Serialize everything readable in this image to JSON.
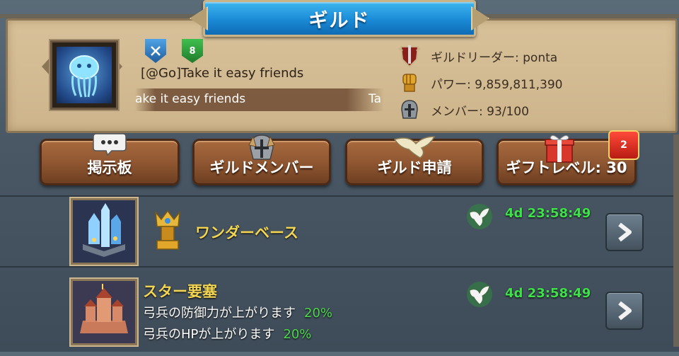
{
  "window": {
    "title": "ギルド"
  },
  "guild": {
    "name": "[@Go]Take it easy friends",
    "marquee_text": "ake it easy friends",
    "marquee_text_next": "Ta",
    "level_badge": "8",
    "leader": "ギルドリーダー: ponta",
    "power": "パワー: 9,859,811,390",
    "members": "メンバー: 93/100"
  },
  "buttons": [
    {
      "label": "掲示板",
      "icon": "chat-bubble-icon"
    },
    {
      "label": "ギルドメンバー",
      "icon": "helmet-icon"
    },
    {
      "label": "ギルド申請",
      "icon": "dove-icon"
    },
    {
      "label": "ギフトレベル: 30",
      "icon": "gift-icon"
    }
  ],
  "notification": {
    "count": "2"
  },
  "rows": [
    {
      "title": "ワンダーベース",
      "timer": "4d 23:58:49",
      "icon": "crown-trophy-icon"
    },
    {
      "title": "スター要塞",
      "timer": "4d 23:58:49",
      "buffs": [
        {
          "text": "弓兵の防御力が上がります",
          "value": "20%"
        },
        {
          "text": "弓兵のHPが上がります",
          "value": "20%"
        }
      ]
    }
  ],
  "colors": {
    "accent_blue": "#1a8ad6",
    "timer_green": "#3fe04a",
    "title_yellow": "#f2d552",
    "button_brown": "#8d5530"
  }
}
